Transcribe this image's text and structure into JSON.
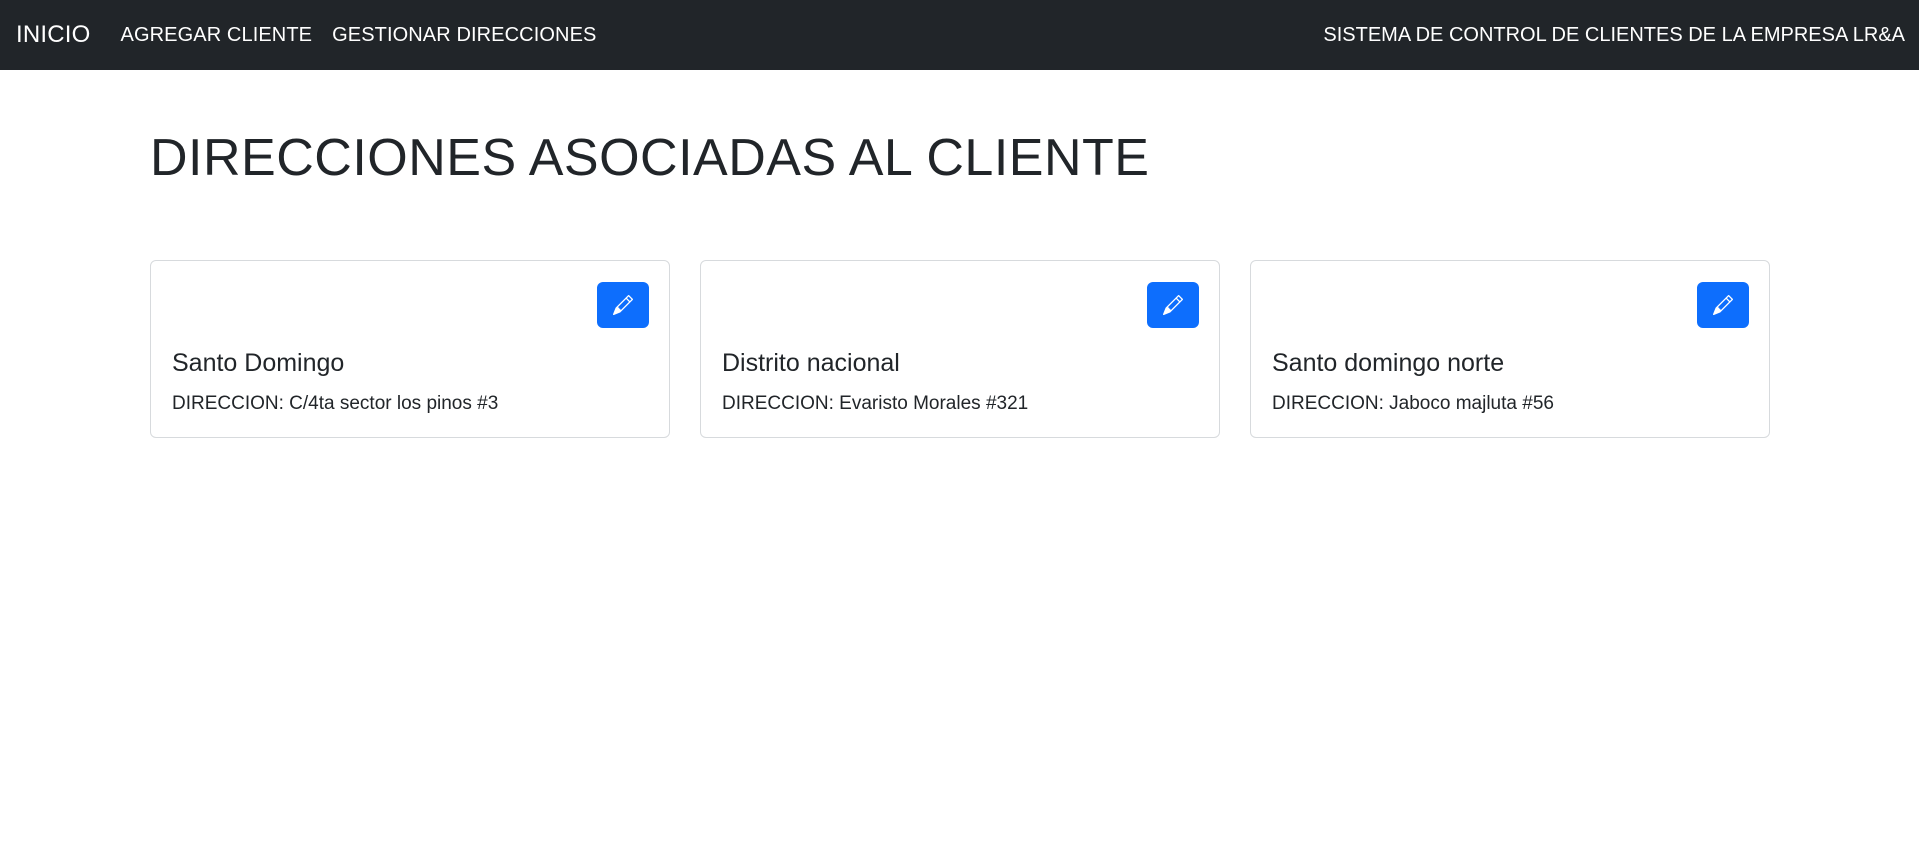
{
  "navbar": {
    "brand": "INICIO",
    "links": [
      {
        "label": "AGREGAR CLIENTE"
      },
      {
        "label": "GESTIONAR DIRECCIONES"
      }
    ],
    "right_text": "SISTEMA DE CONTROL DE CLIENTES DE LA EMPRESA LR&A"
  },
  "page": {
    "title": "DIRECCIONES ASOCIADAS AL CLIENTE"
  },
  "cards": [
    {
      "title": "Santo Domingo",
      "address": "DIRECCION: C/4ta sector los pinos #3",
      "button_icon": "pencil-icon"
    },
    {
      "title": "Distrito nacional",
      "address": "DIRECCION: Evaristo Morales #321",
      "button_icon": "pencil-icon"
    },
    {
      "title": "Santo domingo norte",
      "address": "DIRECCION: Jaboco majluta #56",
      "button_icon": "pencil-icon"
    }
  ],
  "colors": {
    "navbar_bg": "#212529",
    "button_primary": "#0d6efd",
    "card_border": "#d7dadd"
  }
}
